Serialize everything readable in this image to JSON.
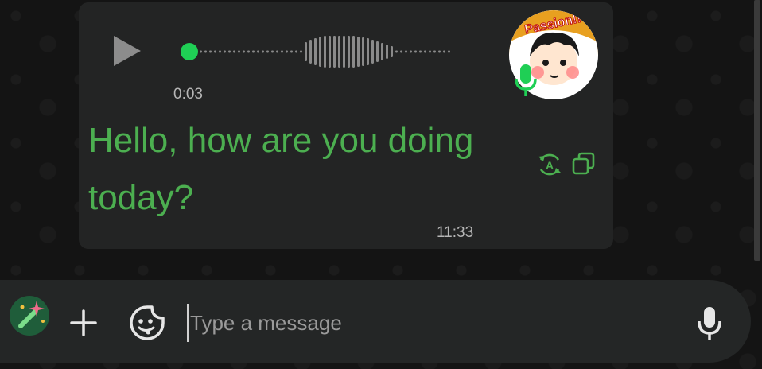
{
  "voice_message": {
    "duration": "0:03",
    "transcript": "Hello, how are you doing today?",
    "time": "11:33",
    "avatar_text": "Passion!!"
  },
  "composer": {
    "placeholder": "Type a message"
  },
  "icons": {
    "play": "play-icon",
    "mic_badge": "microphone-icon",
    "translate": "translate-icon",
    "copy": "copy-icon",
    "ai": "magic-wand-icon",
    "plus": "plus-icon",
    "sticker": "sticker-icon",
    "voice": "microphone-icon"
  },
  "colors": {
    "accent": "#1fcf55",
    "transcript": "#4caf50",
    "bubble": "#232424",
    "composer": "#242626"
  }
}
